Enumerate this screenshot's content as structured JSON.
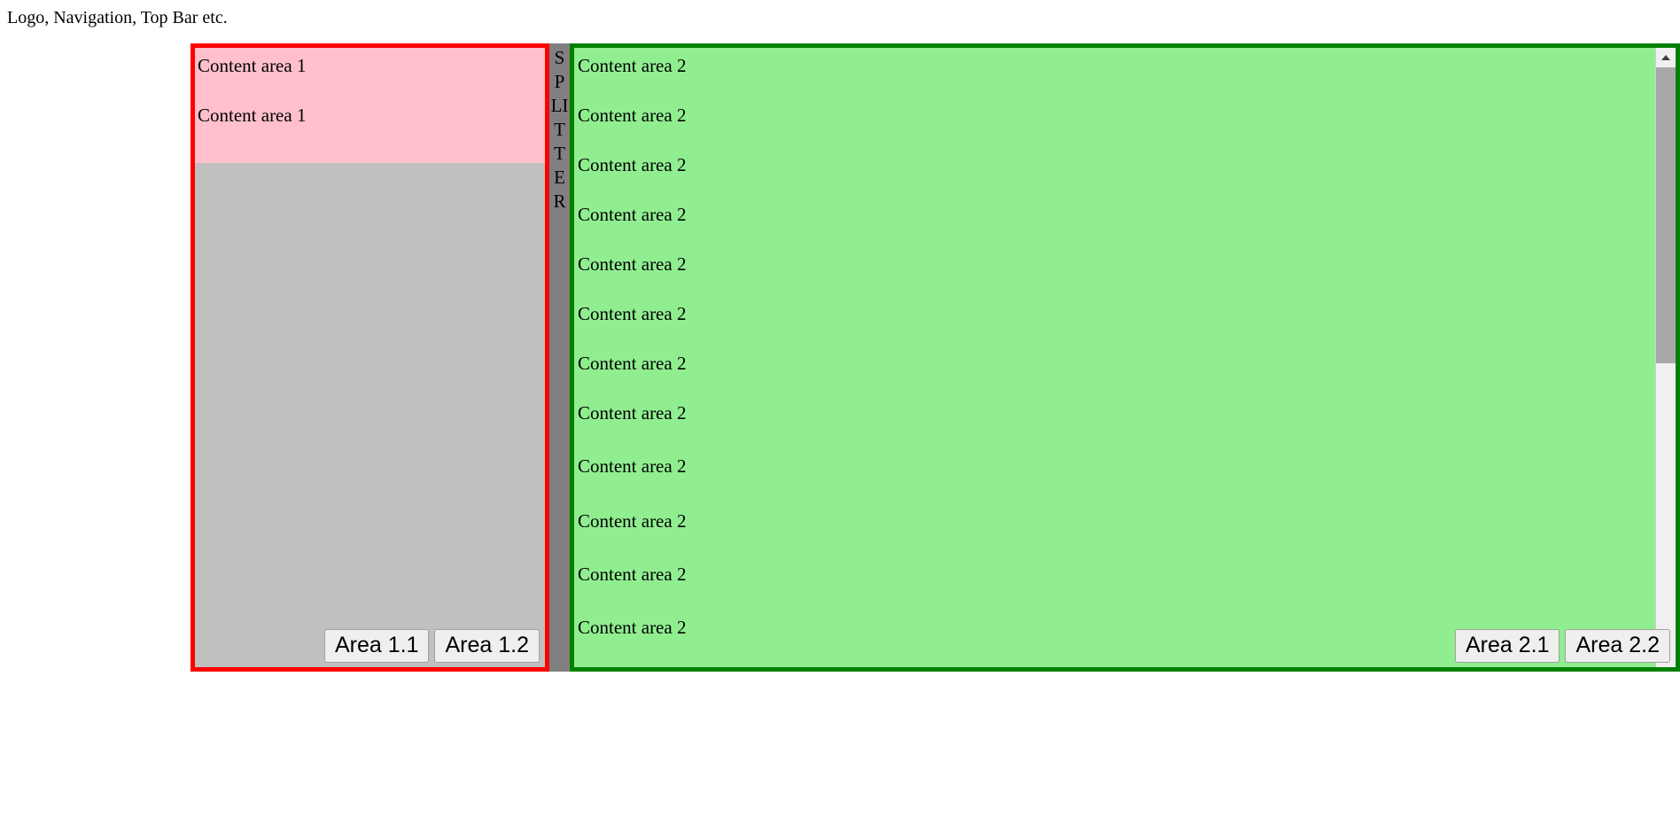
{
  "topbar": {
    "text": "Logo, Navigation, Top Bar etc."
  },
  "splitter": {
    "label": "SPLITTER",
    "name": "vertical-splitter"
  },
  "left_pane": {
    "border_color": "#ff0000",
    "background_color": "#ffc0cb",
    "filler_color": "#c0c0c0",
    "lines": [
      "Content area 1",
      "Content area 1"
    ],
    "buttons": [
      "Area 1.1",
      "Area 1.2"
    ]
  },
  "right_pane": {
    "border_color": "#008000",
    "background_color": "#90ee90",
    "lines": [
      "Content area 2",
      "Content area 2",
      "Content area 2",
      "Content area 2",
      "Content area 2",
      "Content area 2",
      "Content area 2",
      "Content area 2",
      "Content area 2",
      "Content area 2",
      "Content area 2",
      "Content area 2"
    ],
    "buttons": [
      "Area 2.1",
      "Area 2.2"
    ],
    "scrollbar": {
      "up_arrow_icon": "chevron-up-icon",
      "down_arrow_icon": "chevron-down-icon",
      "thumb_color": "#a8a8a8",
      "track_color": "#f0f0f0"
    }
  }
}
